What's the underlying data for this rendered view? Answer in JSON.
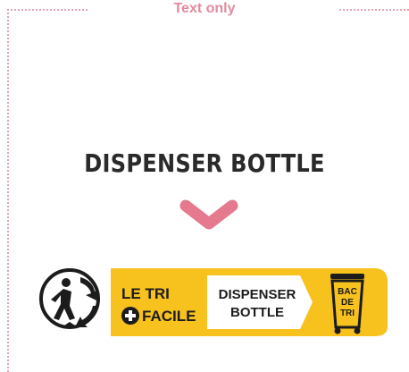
{
  "section": {
    "title": "Text only"
  },
  "product": {
    "name": "DISPENSER BOTTLE"
  },
  "triman": {
    "le_tri": "LE TRI",
    "facile": "FACILE",
    "product_line1": "DISPENSER",
    "product_line2": "BOTTLE",
    "bin_line1": "BAC",
    "bin_line2": "DE",
    "bin_line3": "TRI"
  },
  "icons": {
    "chevron": "chevron-down-icon",
    "triman": "triman-person-arrows-icon",
    "plus": "plus-circle-icon",
    "bin": "recycling-bin-icon"
  },
  "colors": {
    "accent_pink": "#e5798d",
    "frame_pink": "#e7a1b0",
    "title_pink": "#e28a9e",
    "yellow": "#f7c11e",
    "dark": "#1c1c1c"
  }
}
